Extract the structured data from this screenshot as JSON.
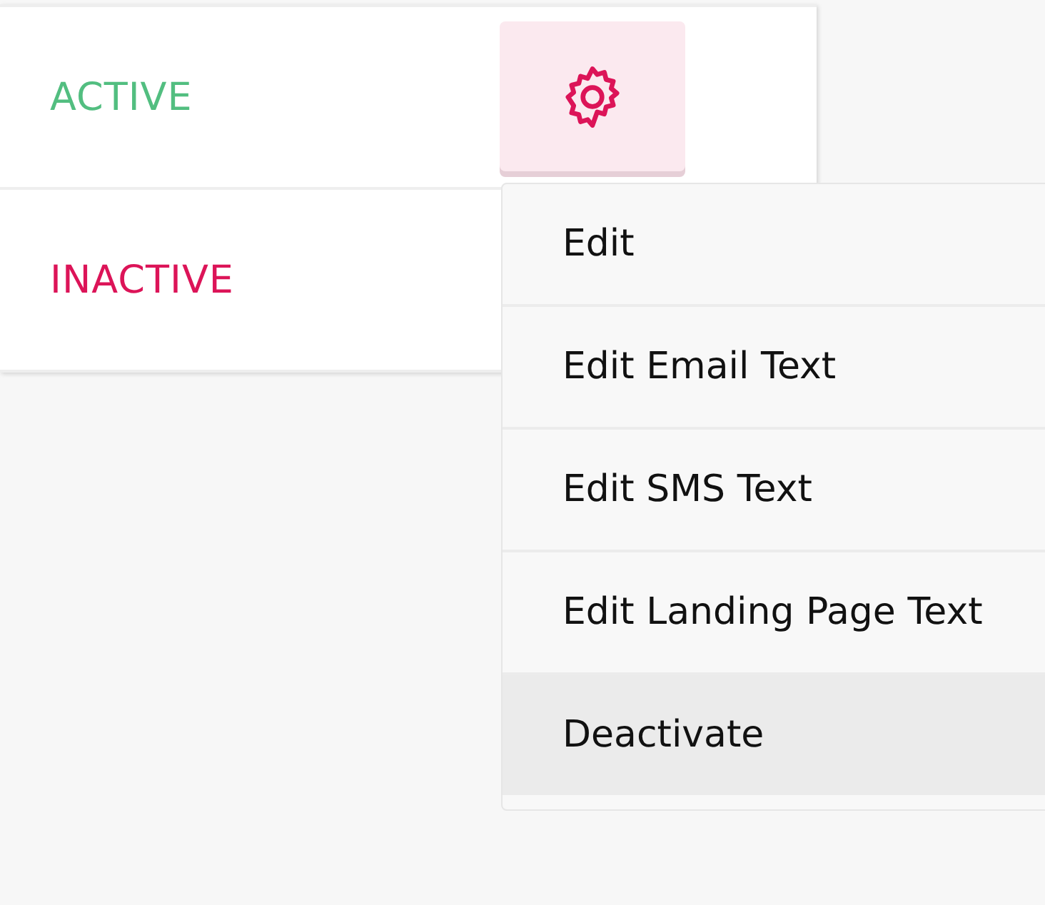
{
  "rows": [
    {
      "status": "ACTIVE",
      "kind": "active",
      "has_settings_button": true
    },
    {
      "status": "INACTIVE",
      "kind": "inactive",
      "has_settings_button": false
    }
  ],
  "menu": {
    "items": [
      {
        "label": "Edit",
        "selected": false
      },
      {
        "label": "Edit Email Text",
        "selected": false
      },
      {
        "label": "Edit SMS Text",
        "selected": false
      },
      {
        "label": "Edit Landing Page Text",
        "selected": false
      },
      {
        "label": "Deactivate",
        "selected": true
      }
    ]
  }
}
